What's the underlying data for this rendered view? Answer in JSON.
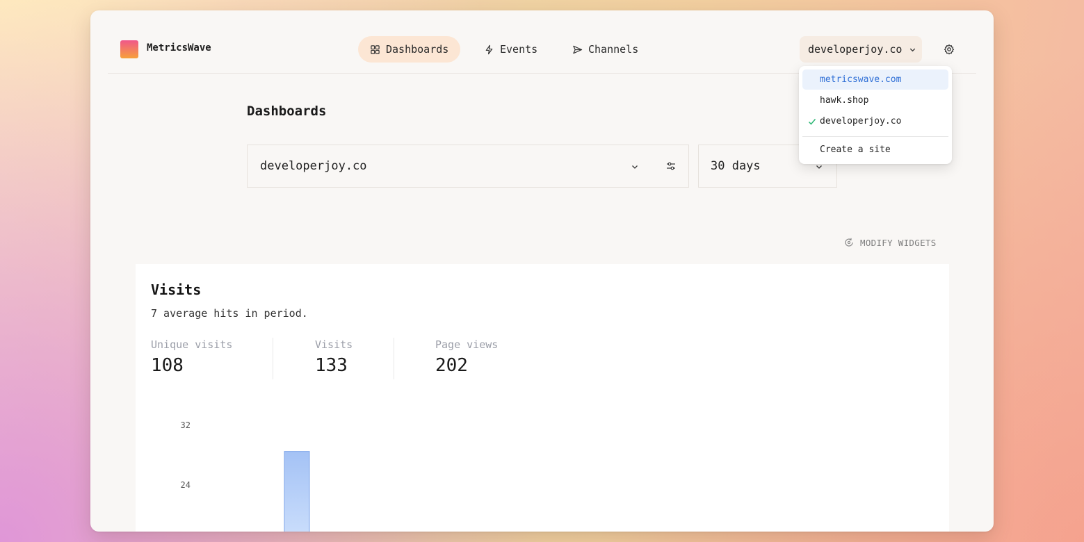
{
  "app": {
    "name": "MetricsWave"
  },
  "nav": [
    {
      "label": "Dashboards",
      "icon": "grid-icon",
      "active": true
    },
    {
      "label": "Events",
      "icon": "lightning-icon",
      "active": false
    },
    {
      "label": "Channels",
      "icon": "send-icon",
      "active": false
    }
  ],
  "site_switcher": {
    "label": "developerjoy.co"
  },
  "site_menu": {
    "items": [
      {
        "label": "metricswave.com",
        "highlighted": true,
        "checked": false
      },
      {
        "label": "hawk.shop",
        "highlighted": false,
        "checked": false
      },
      {
        "label": "developerjoy.co",
        "highlighted": false,
        "checked": true
      }
    ],
    "create_label": "Create a site"
  },
  "page": {
    "title": "Dashboards"
  },
  "filters": {
    "site_value": "developerjoy.co",
    "range_value": "30 days"
  },
  "modify_widgets_label": "MODIFY WIDGETS",
  "visits_card": {
    "title": "Visits",
    "subtitle": "7 average hits in period.",
    "stats": [
      {
        "label": "Unique visits",
        "value": "108"
      },
      {
        "label": "Visits",
        "value": "133"
      },
      {
        "label": "Page views",
        "value": "202"
      }
    ]
  },
  "chart_data": {
    "type": "bar",
    "y_ticks": [
      32,
      24
    ],
    "values": [
      28.5
    ],
    "color": "#a8c8f7"
  },
  "colors": {
    "accent": "#2f6fd6",
    "active_nav_bg": "#fce6d4",
    "check": "#2bb673"
  }
}
